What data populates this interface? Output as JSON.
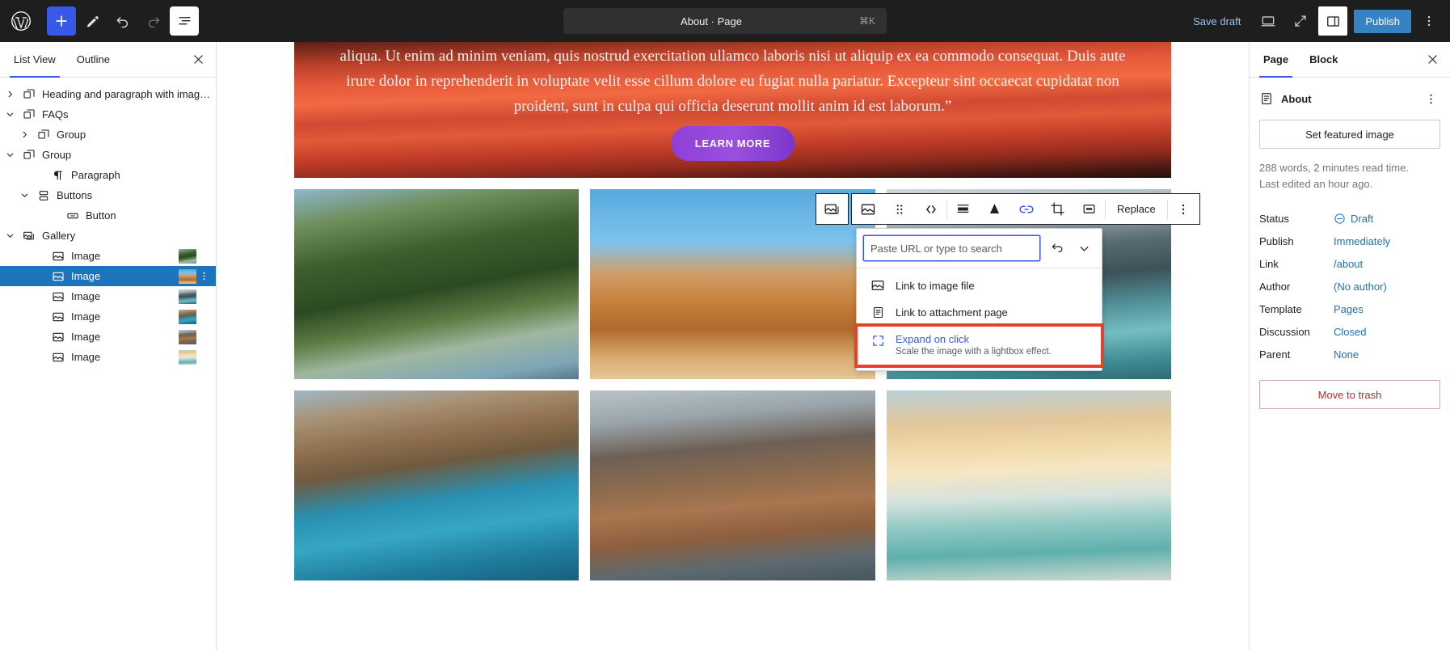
{
  "topbar": {
    "logo_icon": "wordpress-logo-icon",
    "add_block_label": "+",
    "add_block_icon": "plus-icon",
    "edit_icon": "pencil-edit-icon",
    "undo_icon": "undo-arrow-icon",
    "redo_icon": "redo-arrow-icon",
    "listview_icon": "list-view-icon",
    "document_title": "About · Page",
    "shortcut": "⌘K",
    "save_draft_label": "Save draft",
    "preview_icon": "desktop-preview-icon",
    "fullscreen_icon": "expand-fullscreen-icon",
    "settings_sidebar_icon": "settings-sidebar-icon",
    "publish_label": "Publish",
    "more_options_icon": "kebab-menu-icon"
  },
  "leftbar": {
    "tabs": [
      {
        "label": "List View",
        "active": true
      },
      {
        "label": "Outline",
        "active": false
      }
    ],
    "close_icon": "close-icon",
    "tree": [
      {
        "label": "Heading and paragraph with image on t…",
        "icon": "group-block-icon",
        "indent": 0,
        "chevron": "right",
        "selected": false,
        "thumb": ""
      },
      {
        "label": "FAQs",
        "icon": "group-block-icon",
        "indent": 0,
        "chevron": "down",
        "selected": false,
        "thumb": ""
      },
      {
        "label": "Group",
        "icon": "group-block-icon",
        "indent": 1,
        "chevron": "right",
        "selected": false,
        "thumb": ""
      },
      {
        "label": "Group",
        "icon": "group-block-icon",
        "indent": 0,
        "chevron": "down",
        "selected": false,
        "thumb": ""
      },
      {
        "label": "Paragraph",
        "icon": "paragraph-block-icon",
        "indent": 2,
        "chevron": "none",
        "selected": false,
        "thumb": ""
      },
      {
        "label": "Buttons",
        "icon": "buttons-block-icon",
        "indent": 1,
        "chevron": "down",
        "selected": false,
        "thumb": ""
      },
      {
        "label": "Button",
        "icon": "button-block-icon",
        "indent": 3,
        "chevron": "none",
        "selected": false,
        "thumb": ""
      },
      {
        "label": "Gallery",
        "icon": "gallery-block-icon",
        "indent": 0,
        "chevron": "down",
        "selected": false,
        "thumb": ""
      },
      {
        "label": "Image",
        "icon": "image-block-icon",
        "indent": 2,
        "chevron": "none",
        "selected": false,
        "thumb": "p1"
      },
      {
        "label": "Image",
        "icon": "image-block-icon",
        "indent": 2,
        "chevron": "none",
        "selected": true,
        "thumb": "p2"
      },
      {
        "label": "Image",
        "icon": "image-block-icon",
        "indent": 2,
        "chevron": "none",
        "selected": false,
        "thumb": "p3"
      },
      {
        "label": "Image",
        "icon": "image-block-icon",
        "indent": 2,
        "chevron": "none",
        "selected": false,
        "thumb": "p4"
      },
      {
        "label": "Image",
        "icon": "image-block-icon",
        "indent": 2,
        "chevron": "none",
        "selected": false,
        "thumb": "p5"
      },
      {
        "label": "Image",
        "icon": "image-block-icon",
        "indent": 2,
        "chevron": "none",
        "selected": false,
        "thumb": "p6"
      }
    ]
  },
  "canvas": {
    "hero_paragraph": "aliqua. Ut enim ad minim veniam, quis nostrud exercitation ullamco laboris nisi ut aliquip ex ea commodo consequat. Duis aute irure dolor in reprehenderit in voluptate velit esse cillum dolore eu fugiat nulla pariatur. Excepteur sint occaecat cupidatat non proident, sunt in culpa qui officia deserunt mollit anim id est laborum.”",
    "learn_more_label": "LEARN MORE",
    "gallery_images": [
      {
        "name": "forest-river-photo",
        "cls": "p1"
      },
      {
        "name": "desert-dunes-photo",
        "cls": "p2"
      },
      {
        "name": "mountain-lake-photo",
        "cls": "p3"
      },
      {
        "name": "coastal-cliff-photo",
        "cls": "p4"
      },
      {
        "name": "rocky-lighthouse-photo",
        "cls": "p5"
      },
      {
        "name": "beach-sunset-photo",
        "cls": "p6"
      }
    ]
  },
  "block_toolbar": {
    "parent_block_icon": "gallery-block-icon",
    "buttons": [
      {
        "name": "image-block-icon",
        "active": false
      },
      {
        "name": "drag-handle-icon",
        "active": false
      },
      {
        "name": "move-arrows-icon",
        "active": false
      },
      {
        "name": "align-icon",
        "active": false
      },
      {
        "name": "text-color-icon",
        "active": false
      },
      {
        "name": "link-icon",
        "active": true
      },
      {
        "name": "crop-icon",
        "active": false
      },
      {
        "name": "more-image-options-icon",
        "active": false
      }
    ],
    "replace_label": "Replace",
    "kebab_icon": "kebab-menu-icon"
  },
  "link_popover": {
    "input_value": "",
    "input_placeholder": "Paste URL or type to search",
    "submit_icon": "submit-arrow-icon",
    "expand_icon": "chevron-down-icon",
    "items": [
      {
        "label": "Link to image file",
        "icon": "image-file-icon",
        "description": "",
        "highlighted": false
      },
      {
        "label": "Link to attachment page",
        "icon": "attachment-page-icon",
        "description": "",
        "highlighted": false
      },
      {
        "label": "Expand on click",
        "icon": "expand-on-click-icon",
        "description": "Scale the image with a lightbox effect.",
        "highlighted": true
      }
    ]
  },
  "rightbar": {
    "tabs": [
      {
        "label": "Page",
        "active": true
      },
      {
        "label": "Block",
        "active": false
      }
    ],
    "close_icon": "close-icon",
    "document_icon": "page-document-icon",
    "document_title": "About",
    "kebab_icon": "kebab-menu-icon",
    "featured_image_label": "Set featured image",
    "word_count_text": "288 words, 2 minutes read time.",
    "last_edited_text": "Last edited an hour ago.",
    "settings": [
      {
        "label": "Status",
        "value": "Draft",
        "icon": "draft-status-icon"
      },
      {
        "label": "Publish",
        "value": "Immediately",
        "icon": ""
      },
      {
        "label": "Link",
        "value": "/about",
        "icon": ""
      },
      {
        "label": "Author",
        "value": "(No author)",
        "icon": ""
      },
      {
        "label": "Template",
        "value": "Pages",
        "icon": ""
      },
      {
        "label": "Discussion",
        "value": "Closed",
        "icon": ""
      },
      {
        "label": "Parent",
        "value": "None",
        "icon": ""
      }
    ],
    "trash_label": "Move to trash"
  },
  "colors": {
    "accent_blue": "#3858e9",
    "publish_blue": "#3582c4",
    "link_blue": "#2271b1",
    "selected_row": "#1e73bd",
    "highlight_red": "#e8402a",
    "trash_red": "#b32d2e",
    "topbar_dark": "#1e1e1e"
  }
}
